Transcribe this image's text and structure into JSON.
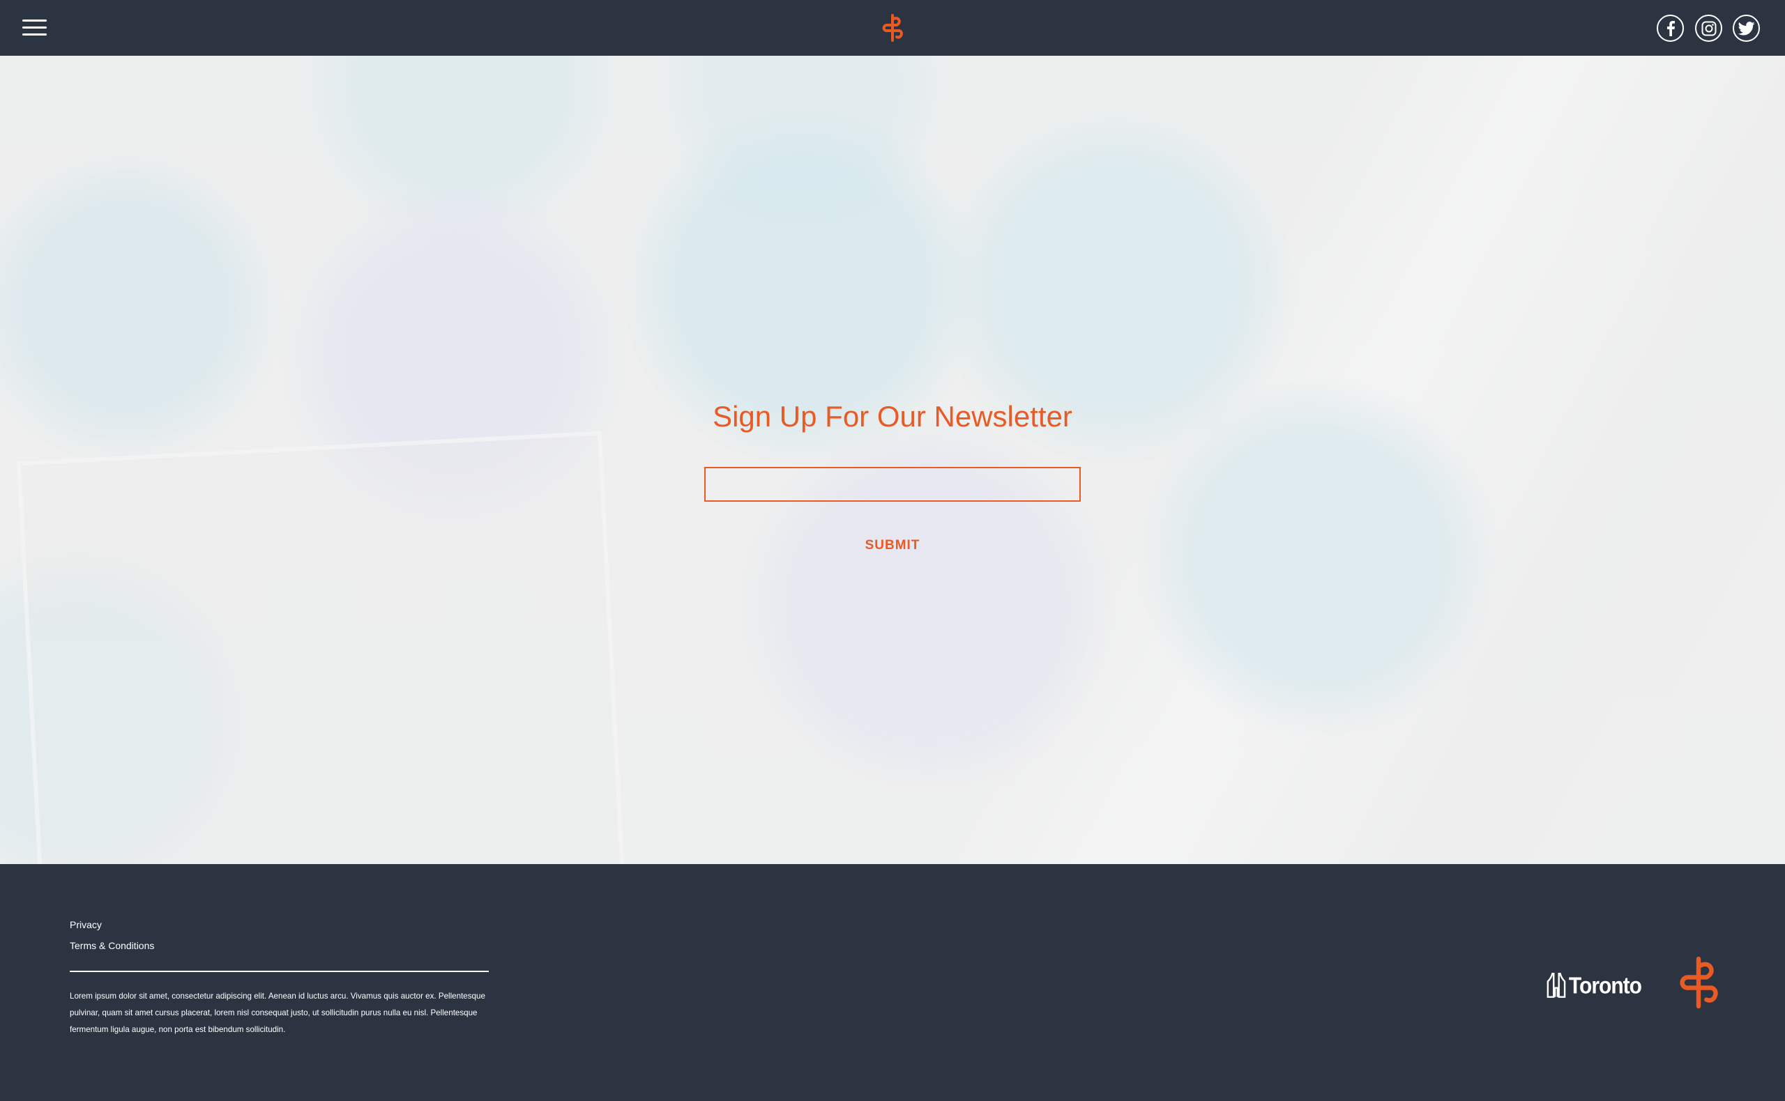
{
  "header": {
    "menu_icon": "hamburger-icon",
    "logo_icon": "brand-logo-icon",
    "social": [
      {
        "name": "facebook",
        "icon": "facebook-icon"
      },
      {
        "name": "instagram",
        "icon": "instagram-icon"
      },
      {
        "name": "twitter",
        "icon": "twitter-icon"
      }
    ]
  },
  "newsletter": {
    "title": "Sign Up For Our Newsletter",
    "email_value": "",
    "email_placeholder": "",
    "submit_label": "SUBMIT"
  },
  "footer": {
    "links": [
      "Privacy",
      "Terms & Conditions"
    ],
    "body_text": "Lorem ipsum dolor sit amet, consectetur adipiscing elit. Aenean id luctus arcu. Vivamus quis auctor ex. Pellentesque pulvinar, quam sit amet cursus placerat, lorem nisl consequat justo, ut sollicitudin purus nulla eu nisl. Pellentesque fermentum ligula augue, non porta est bibendum sollicitudin.",
    "toronto_label": "Toronto",
    "toronto_logo_icon": "toronto-city-hall-icon",
    "brand_logo_icon": "brand-logo-icon"
  },
  "colors": {
    "accent": "#ea5a24",
    "nav_background": "#2d3441",
    "text_light": "#ffffff"
  }
}
